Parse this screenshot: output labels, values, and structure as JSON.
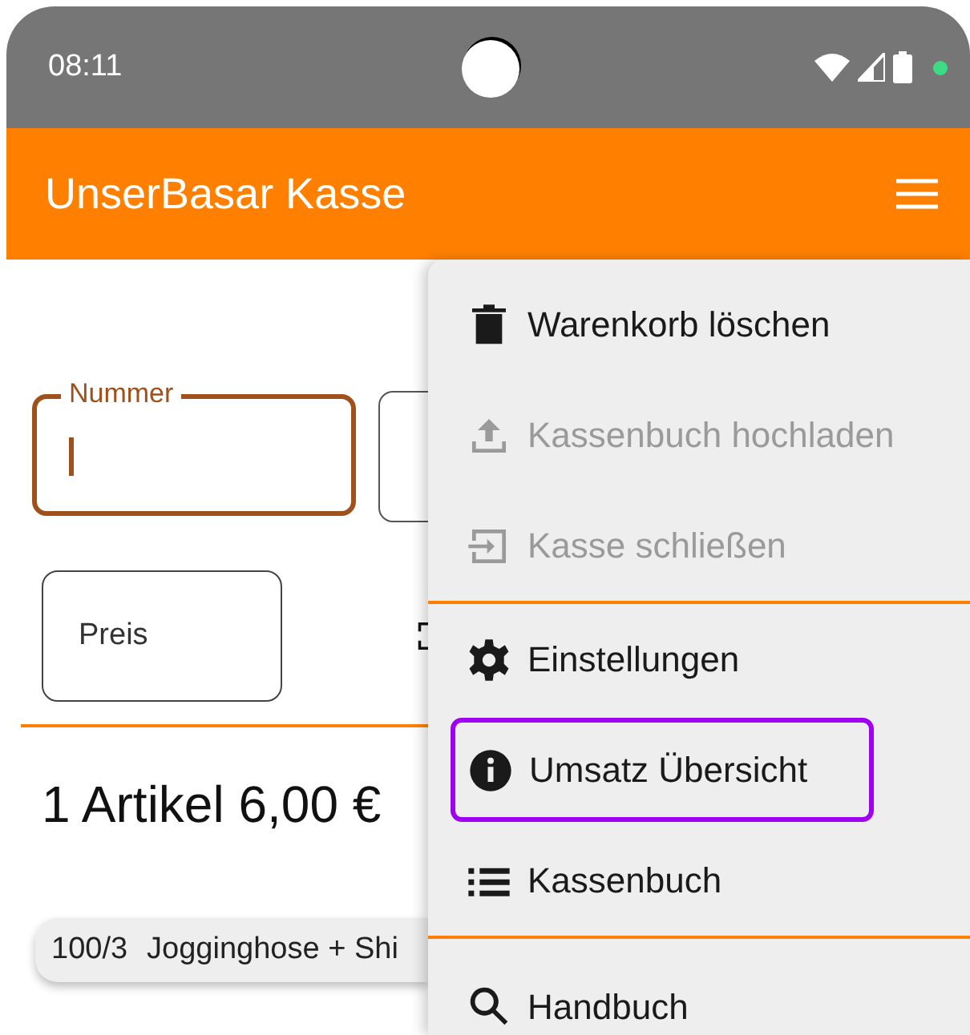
{
  "status_bar": {
    "time": "08:11"
  },
  "app_bar": {
    "title": "UnserBasar Kasse"
  },
  "form": {
    "number_field": {
      "label": "Nummer",
      "focused": true
    },
    "price_field": {
      "placeholder": "Preis"
    }
  },
  "summary": "1 Artikel 6,00 €",
  "cart_items": [
    {
      "number": "100/3",
      "name": "Jogginghose + Shi"
    }
  ],
  "menu": {
    "sections": [
      [
        {
          "label": "Warenkorb löschen",
          "disabled": false,
          "highlighted": false
        },
        {
          "label": "Kassenbuch hochladen",
          "disabled": true,
          "highlighted": false
        },
        {
          "label": "Kasse schließen",
          "disabled": true,
          "highlighted": false
        }
      ],
      [
        {
          "label": "Einstellungen",
          "disabled": false,
          "highlighted": false
        },
        {
          "label": "Umsatz Übersicht",
          "disabled": false,
          "highlighted": true
        },
        {
          "label": "Kassenbuch",
          "disabled": false,
          "highlighted": false
        }
      ],
      [
        {
          "label": "Handbuch",
          "disabled": false,
          "highlighted": false
        }
      ]
    ]
  }
}
